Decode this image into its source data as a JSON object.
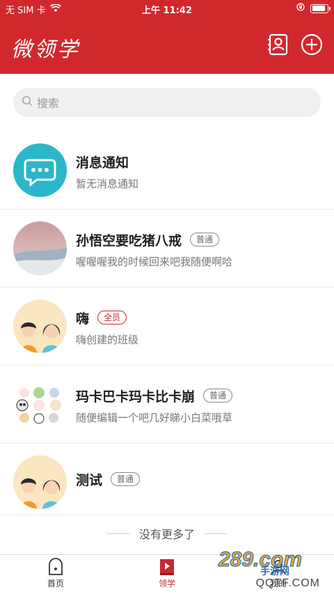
{
  "status_bar": {
    "carrier": "无 SIM 卡",
    "time": "上午 11:42"
  },
  "header": {
    "logo_text": "微领学"
  },
  "search": {
    "placeholder": "搜索"
  },
  "list": [
    {
      "title": "消息通知",
      "subtitle": "暂无消息通知",
      "badge": ""
    },
    {
      "title": "孙悟空要吃猪八戒",
      "subtitle": "喔喔喔我的时候回来吧我随便啊哈",
      "badge": "普通"
    },
    {
      "title": "嗨",
      "subtitle": "嗨创建的班级",
      "badge": "全员"
    },
    {
      "title": "玛卡巴卡玛卡比卡崩",
      "subtitle": "随便编辑一个吧几好睇小白菜哦草",
      "badge": "普通"
    },
    {
      "title": "测试",
      "subtitle": "",
      "badge": "普通"
    }
  ],
  "footer_note": "没有更多了",
  "tabs": [
    {
      "label": "首页"
    },
    {
      "label": "领学"
    },
    {
      "label": "我的"
    }
  ],
  "watermark": {
    "text": "289.com 手游网",
    "domain": "QQTF.COM"
  },
  "colors": {
    "brand": "#d1282e",
    "notice": "#2bb7c9"
  }
}
